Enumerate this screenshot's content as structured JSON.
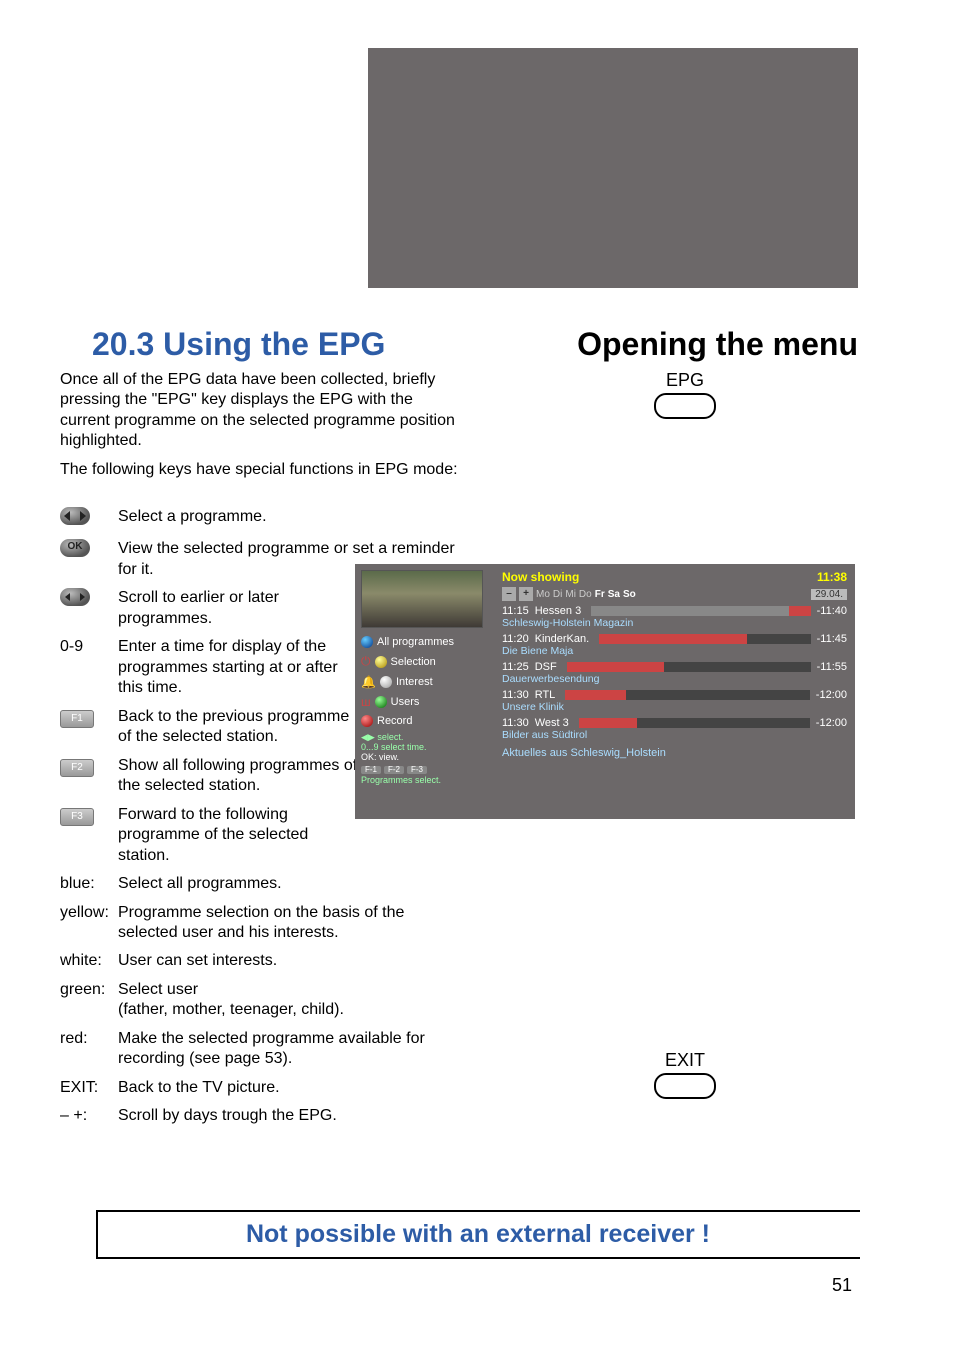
{
  "headings": {
    "left": "20.3 Using the EPG",
    "right": "Opening the menu"
  },
  "intro1": "Once all of the EPG data have been collected, briefly pressing the \"EPG\" key displays the EPG with the current programme on the selected programme position highlighted.",
  "intro2": "The following keys have special functions in EPG mode:",
  "keys": {
    "lr": "Select a programme.",
    "ok": "View the selected programme or set a reminder for it.",
    "lr2": "Scroll to earlier or later programmes.",
    "n09_label": "0-9",
    "n09": "Enter a time for display of the programmes starting at or after this time.",
    "f1_label": "F1",
    "f1": "Back to the previous programme of the selected station.",
    "f2_label": "F2",
    "f2": "Show all following programmes of the selected station.",
    "f3_label": "F3",
    "f3": "Forward to the following programme of the selected station.",
    "blue_label": "blue:",
    "blue": "Select all programmes.",
    "yellow_label": "yellow:",
    "yellow": "Programme selection on the basis of the selected user and his interests.",
    "white_label": "white:",
    "white": "User can set interests.",
    "green_label": "green:",
    "green": "Select user\n(father, mother, teenager, child).",
    "red_label": "red:",
    "red": "Make the selected programme available for recording (see page 53).",
    "exit_label": "EXIT:",
    "exit": "Back to the TV picture.",
    "pm_label": "– +:",
    "pm": "Scroll by days trough the EPG."
  },
  "right_keys": {
    "epg": "EPG",
    "exit": "EXIT"
  },
  "epg_panel": {
    "left_opts": {
      "all": "All programmes",
      "selection": "Selection",
      "interest": "Interest",
      "users": "Users",
      "record": "Record"
    },
    "legend": {
      "select": "select.",
      "select_time": "0...9 select time.",
      "ok_view": "OK: view.",
      "f_labels": [
        "F-1",
        "F-2",
        "F-3"
      ],
      "prog_sel": "Programmes select."
    },
    "title": "Now showing",
    "clock": "11:38",
    "days_pm": [
      "–",
      "+"
    ],
    "days": [
      "Mo",
      "Di",
      "Mi",
      "Do",
      "Fr",
      "Sa",
      "So"
    ],
    "date": "29.04.",
    "items": [
      {
        "time": "11:15",
        "ch": "Hessen 3",
        "end": "-11:40",
        "sub": "Schleswig-Holstein Magazin",
        "fill": 90
      },
      {
        "time": "11:20",
        "ch": "KinderKan.",
        "end": "-11:45",
        "sub": "Die Biene Maja",
        "fill": 70
      },
      {
        "time": "11:25",
        "ch": "DSF",
        "end": "-11:55",
        "sub": "Dauerwerbesendung",
        "fill": 40
      },
      {
        "time": "11:30",
        "ch": "RTL",
        "end": "-12:00",
        "sub": "Unsere Klinik",
        "fill": 25
      },
      {
        "time": "11:30",
        "ch": "West 3",
        "end": "-12:00",
        "sub": "Bilder aus Südtirol",
        "fill": 25
      }
    ],
    "bottom": "Aktuelles aus Schleswig_Holstein"
  },
  "footer": "Not possible with an external receiver !",
  "page_number": "51"
}
